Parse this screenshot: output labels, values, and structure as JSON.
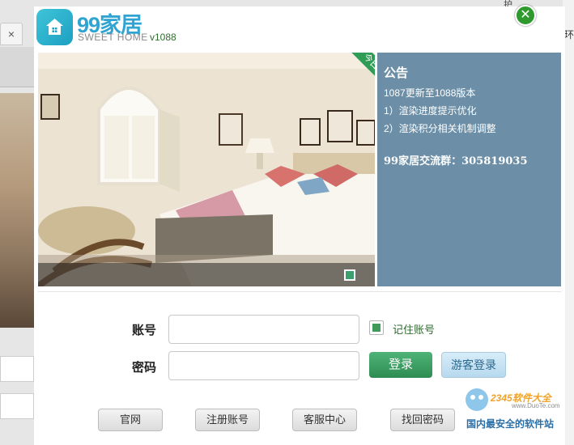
{
  "background": {
    "tab_close": "×",
    "right_char": "环",
    "top_text": "护"
  },
  "titlebar": {
    "logo_text": "99家居",
    "logo_subtitle": "SWEET HOME",
    "version": "v1088",
    "close_label": "✕"
  },
  "banner": {
    "ribbon_text": "今日之星",
    "watermark": "www.DuoTe.com"
  },
  "notice": {
    "title": "公告",
    "lines": [
      "1087更新至1088版本",
      "1）渲染进度提示优化",
      "2）渲染积分相关机制调整"
    ],
    "group": "99家居交流群：305819035"
  },
  "login": {
    "account_label": "账号",
    "password_label": "密码",
    "account_value": "",
    "password_value": "",
    "remember_label": "记住账号",
    "remember_checked": true,
    "login_button": "登录",
    "guest_button": "游客登录"
  },
  "footer": {
    "buttons": [
      "官网",
      "注册账号",
      "客服中心",
      "找回密码"
    ]
  },
  "site_watermark": {
    "title": "2345软件大全",
    "url": "www.DuoTe.com",
    "slogan": "国内最安全的软件站"
  },
  "colors": {
    "accent_green": "#2e9a2e",
    "notice_bg": "#6c8fa7",
    "logo_blue": "#2fa4d2"
  }
}
